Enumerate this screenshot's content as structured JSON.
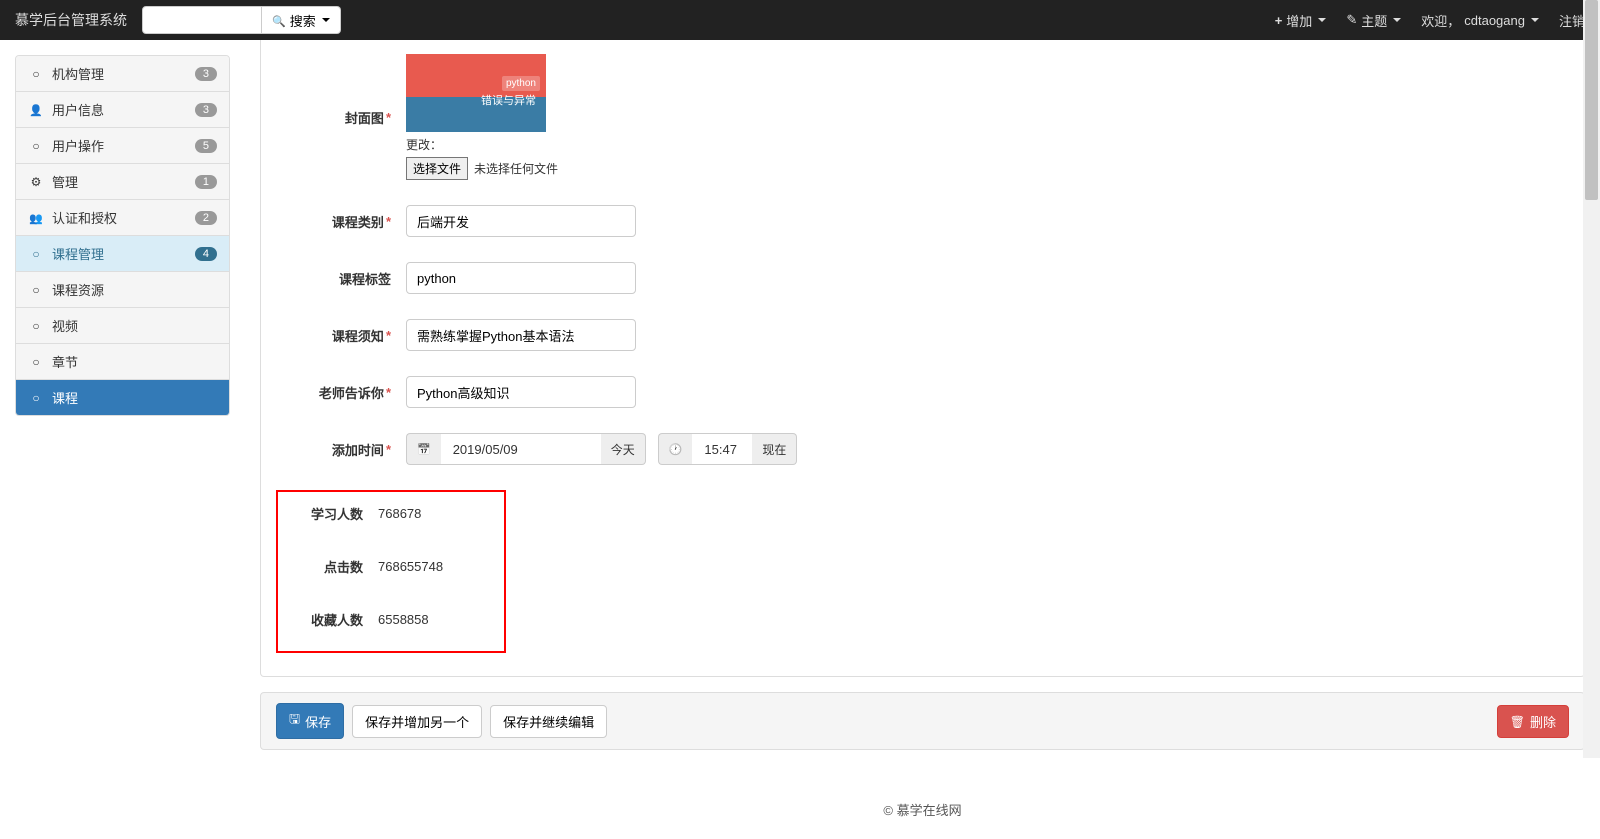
{
  "navbar": {
    "brand": "慕学后台管理系统",
    "search_placeholder": "",
    "search_btn": "搜索",
    "add": "增加",
    "theme": "主题",
    "welcome": "欢迎，",
    "username": "cdtaogang",
    "logout": "注销"
  },
  "sidebar": {
    "items": [
      {
        "icon": "circle",
        "label": "机构管理",
        "badge": "3"
      },
      {
        "icon": "user",
        "label": "用户信息",
        "badge": "3"
      },
      {
        "icon": "circle",
        "label": "用户操作",
        "badge": "5"
      },
      {
        "icon": "cog",
        "label": "管理",
        "badge": "1"
      },
      {
        "icon": "group",
        "label": "认证和授权",
        "badge": "2"
      },
      {
        "icon": "circle",
        "label": "课程管理",
        "badge": "4",
        "active": "secondary"
      },
      {
        "icon": "circle",
        "label": "课程资源",
        "badge": ""
      },
      {
        "icon": "circle",
        "label": "视频",
        "badge": ""
      },
      {
        "icon": "circle",
        "label": "章节",
        "badge": ""
      },
      {
        "icon": "circle",
        "label": "课程",
        "badge": "",
        "active": "primary"
      }
    ]
  },
  "form": {
    "cover_label": "封面图",
    "cover_change": "更改：",
    "cover_file_btn": "选择文件",
    "cover_file_hint": "未选择任何文件",
    "cover_py_label": "python",
    "cover_py_sub": "错误与异常",
    "category_label": "课程类别",
    "category_value": "后端开发",
    "tag_label": "课程标签",
    "tag_value": "python",
    "notice_label": "课程须知",
    "notice_value": "需熟练掌握Python基本语法",
    "teacher_label": "老师告诉你",
    "teacher_value": "Python高级知识",
    "add_time_label": "添加时间",
    "add_date_value": "2019/05/09",
    "today_btn": "今天",
    "add_time_value": "15:47",
    "now_btn": "现在",
    "students_label": "学习人数",
    "students_value": "768678",
    "clicks_label": "点击数",
    "clicks_value": "768655748",
    "favs_label": "收藏人数",
    "favs_value": "6558858"
  },
  "actions": {
    "save": "保存",
    "save_add": "保存并增加另一个",
    "save_continue": "保存并继续编辑",
    "delete": "删除"
  },
  "footer": {
    "text": "© 慕学在线网"
  }
}
